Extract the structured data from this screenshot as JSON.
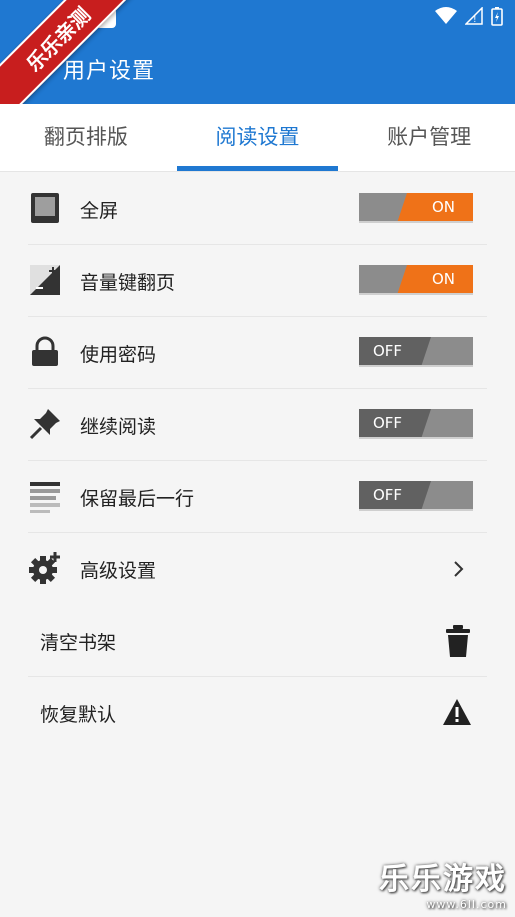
{
  "watermark_ribbon": "乐乐亲测",
  "watermark_corner": {
    "title": "乐乐游戏",
    "url": "www.6ll.com"
  },
  "header": {
    "title": "用户设置"
  },
  "tabs": [
    {
      "label": "翻页排版",
      "active": false
    },
    {
      "label": "阅读设置",
      "active": true
    },
    {
      "label": "账户管理",
      "active": false
    }
  ],
  "settings": [
    {
      "label": "全屏",
      "icon": "fullscreen-icon",
      "state": "ON"
    },
    {
      "label": "音量键翻页",
      "icon": "volume-key-icon",
      "state": "ON"
    },
    {
      "label": "使用密码",
      "icon": "lock-icon",
      "state": "OFF"
    },
    {
      "label": "继续阅读",
      "icon": "pin-icon",
      "state": "OFF"
    },
    {
      "label": "保留最后一行",
      "icon": "lines-icon",
      "state": "OFF"
    }
  ],
  "advanced": {
    "label": "高级设置",
    "icon": "gear-plus-icon"
  },
  "actions": [
    {
      "label": "清空书架",
      "icon": "trash-icon"
    },
    {
      "label": "恢复默认",
      "icon": "warning-icon"
    }
  ],
  "colors": {
    "primary": "#1f78d1",
    "toggle_on": "#ef7218",
    "toggle_off": "#616161"
  }
}
